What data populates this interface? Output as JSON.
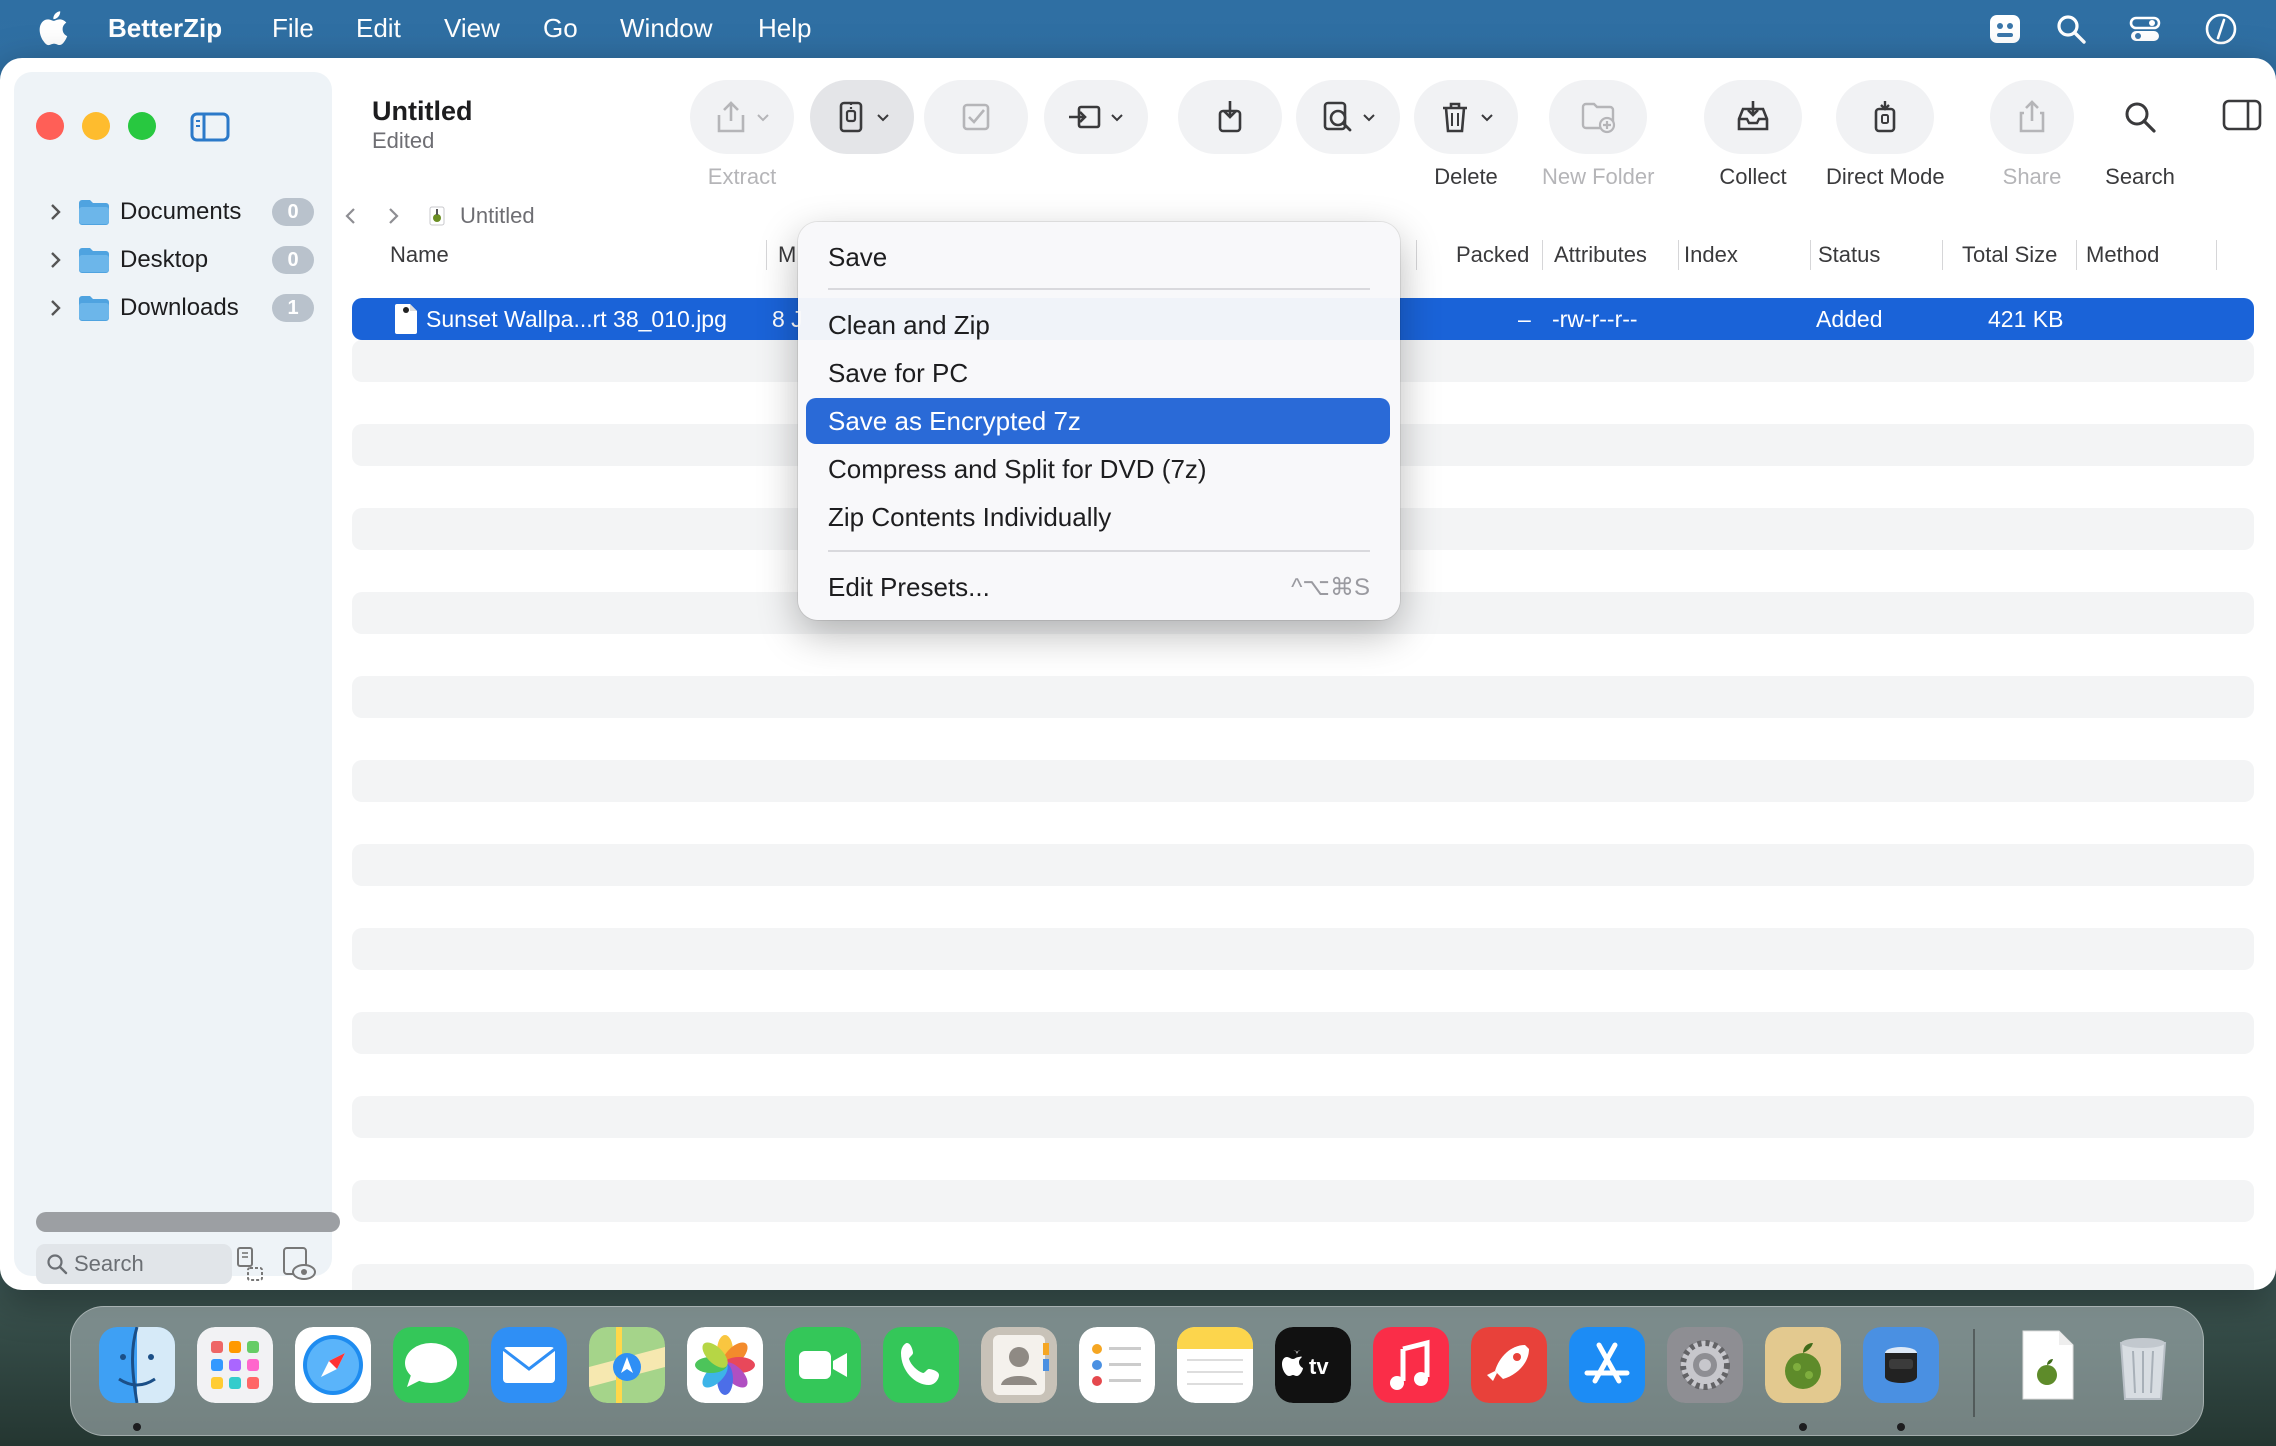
{
  "menubar": {
    "app_name": "BetterZip",
    "items": [
      "File",
      "Edit",
      "View",
      "Go",
      "Window",
      "Help"
    ]
  },
  "window": {
    "title": "Untitled",
    "subtitle": "Edited"
  },
  "sidebar": {
    "items": [
      {
        "label": "Documents",
        "count": "0"
      },
      {
        "label": "Desktop",
        "count": "0"
      },
      {
        "label": "Downloads",
        "count": "1"
      }
    ],
    "search_placeholder": "Search"
  },
  "toolbar": {
    "extract": "Extract",
    "delete": "Delete",
    "new_folder": "New Folder",
    "collect": "Collect",
    "direct_mode": "Direct Mode",
    "share": "Share",
    "search": "Search"
  },
  "pathbar": {
    "current": "Untitled"
  },
  "table": {
    "headers": {
      "name": "Name",
      "modified": "M",
      "packed": "Packed",
      "attributes": "Attributes",
      "index": "Index",
      "status": "Status",
      "total_size": "Total Size",
      "method": "Method"
    },
    "rows": [
      {
        "name": "Sunset Wallpa...rt 38_010.jpg",
        "modified": "8 J",
        "packed": "–",
        "attributes": "-rw-r--r--",
        "status": "Added",
        "total_size": "421 KB"
      }
    ]
  },
  "save_menu": {
    "save": "Save",
    "clean_and_zip": "Clean and Zip",
    "save_for_pc": "Save for PC",
    "save_encrypted": "Save as Encrypted 7z",
    "compress_split": "Compress and Split for DVD (7z)",
    "zip_individually": "Zip Contents Individually",
    "edit_presets": "Edit Presets...",
    "edit_presets_shortcut": "^⌥⌘S",
    "highlighted": "Save as Encrypted 7z"
  },
  "colors": {
    "selection": "#1a63d8",
    "menu_highlight": "#2a6ad7",
    "close": "#ff5f57",
    "minimize": "#febc2e",
    "zoom": "#28c840",
    "folder": "#4fa3e0"
  },
  "dock": {
    "apps": [
      "finder-icon",
      "launchpad-icon",
      "safari-icon",
      "messages-icon",
      "mail-icon",
      "maps-icon",
      "photos-icon",
      "facetime-icon",
      "phone-icon",
      "contacts-icon",
      "reminders-icon",
      "notes-icon",
      "apple-tv-icon",
      "music-icon",
      "rocket-typist-icon",
      "app-store-icon",
      "system-settings-icon",
      "betterzip-icon",
      "scanner-icon"
    ],
    "appletv_label": "tv"
  }
}
